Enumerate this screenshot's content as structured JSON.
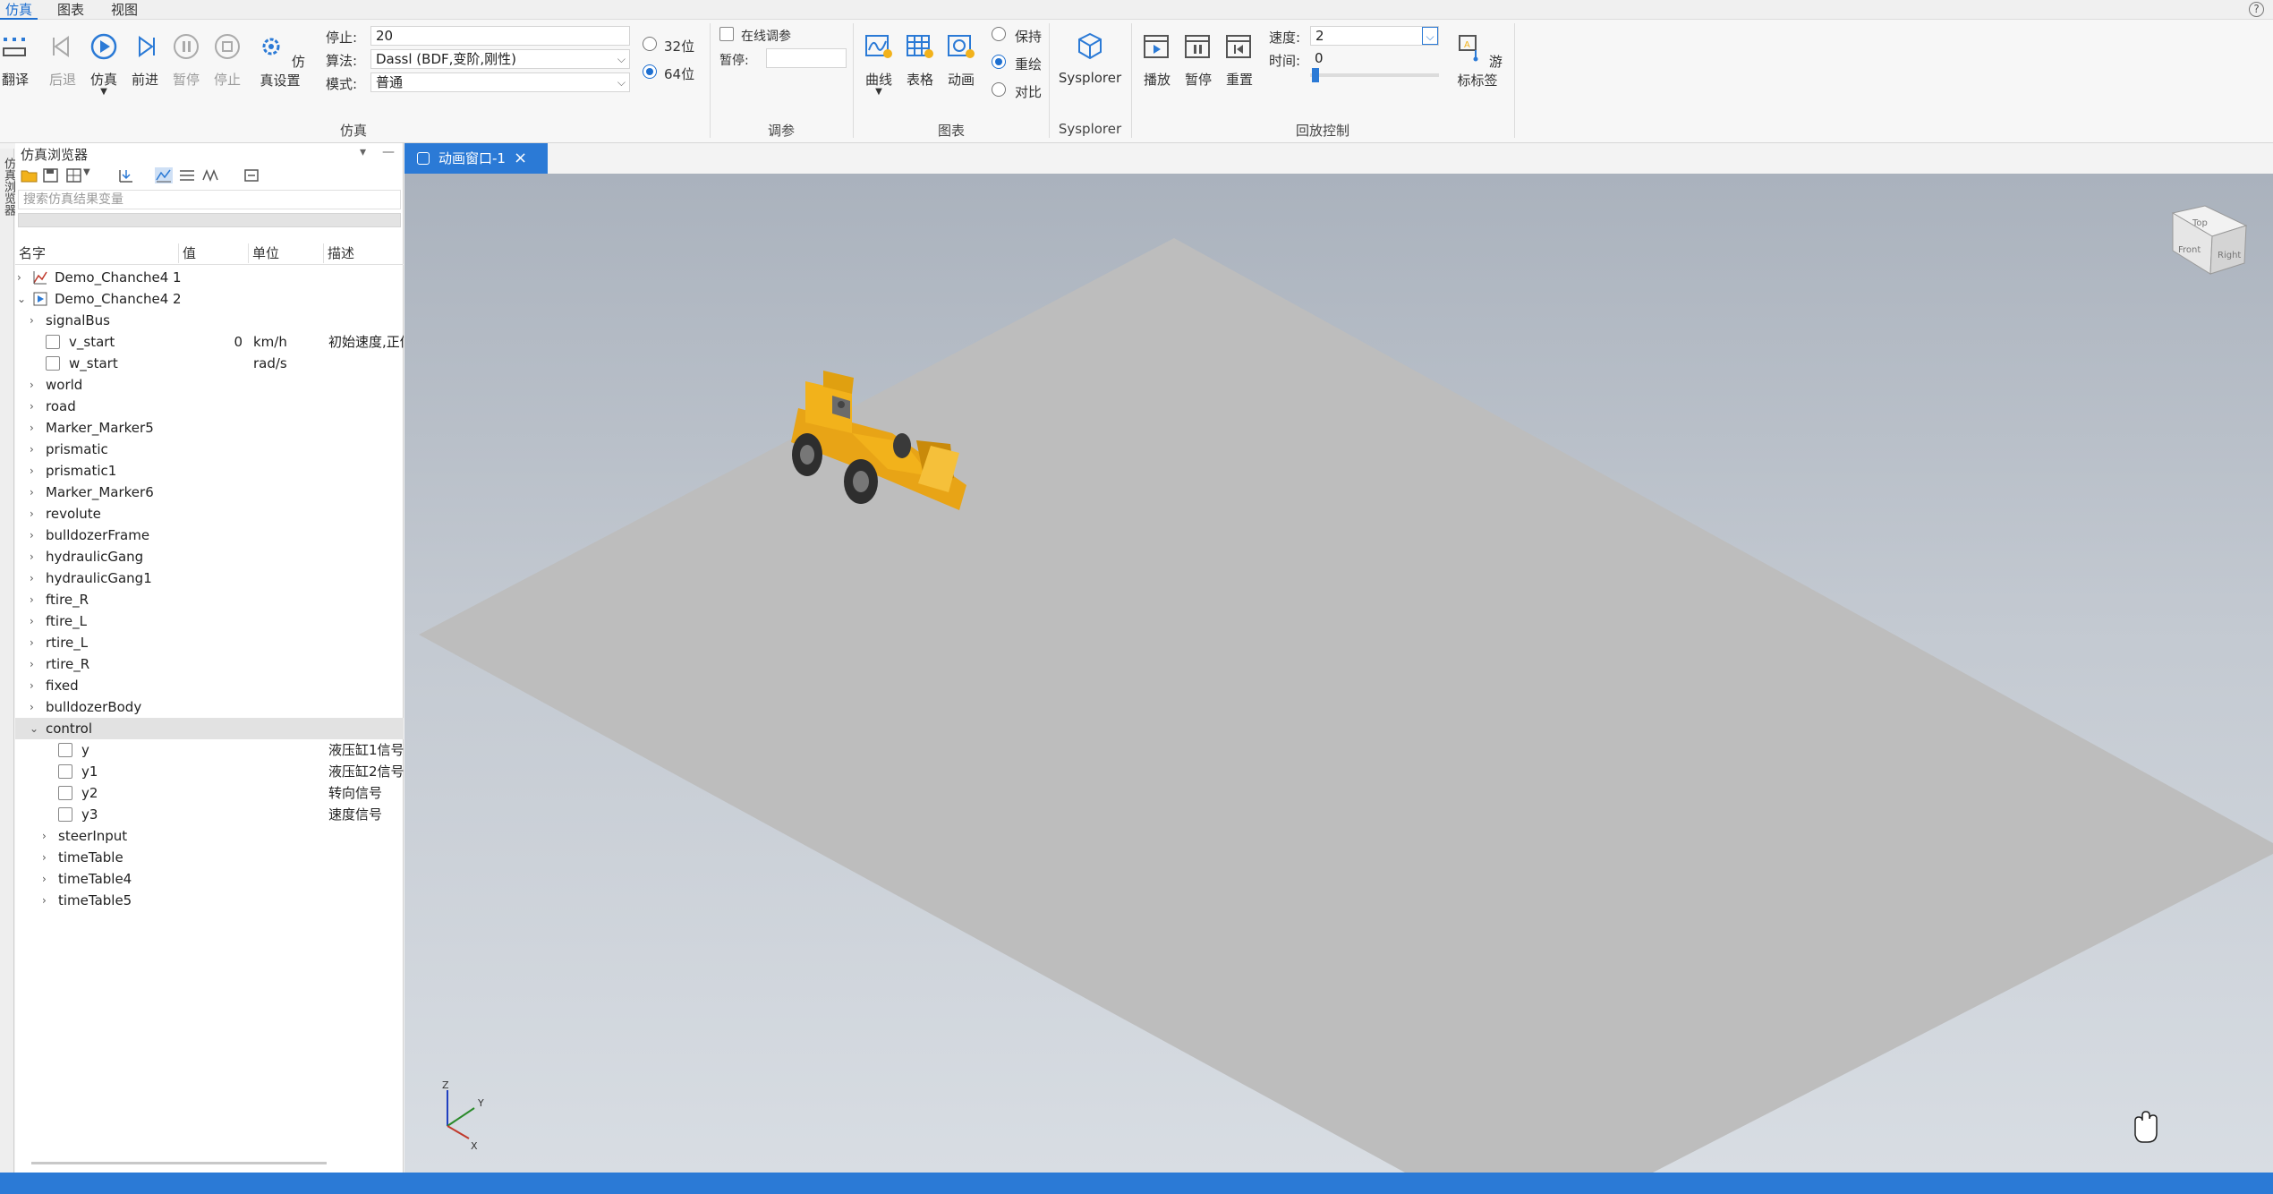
{
  "menu": {
    "items": [
      "仿真",
      "图表",
      "视图"
    ],
    "active": "仿真",
    "help": "?"
  },
  "ribbon": {
    "buttons": {
      "translate": "翻译",
      "back": "后退",
      "simulate": "仿真",
      "forward": "前进",
      "pause": "暂停",
      "stop": "停止",
      "sim_settings": "仿真设置",
      "curve": "曲线",
      "table": "表格",
      "animation": "动画",
      "sysplorer": "Sysplorer",
      "play": "播放",
      "playback_pause": "暂停",
      "reset": "重置",
      "cursor_label": "游标标签"
    },
    "fields": {
      "stop_label": "停止:",
      "stop_value": "20",
      "algo_label": "算法:",
      "algo_value": "Dassl (BDF,变阶,刚性)",
      "mode_label": "模式:",
      "mode_value": "普通",
      "bit32": "32位",
      "bit64": "64位",
      "online_tune": "在线调参",
      "pause_label": "暂停:",
      "keep": "保持",
      "redraw": "重绘",
      "compare": "对比",
      "speed_label": "速度:",
      "speed_value": "2",
      "time_label": "时间:",
      "time_value": "0"
    },
    "groups": {
      "sim": "仿真",
      "tune": "调参",
      "chart": "图表",
      "sysplorer": "Sysplorer",
      "playback": "回放控制"
    }
  },
  "side_tab": "仿真浏览器",
  "browser": {
    "title": "仿真浏览器",
    "search_placeholder": "搜索仿真结果变量",
    "columns": {
      "name": "名字",
      "value": "值",
      "unit": "单位",
      "desc": "描述"
    },
    "rows": [
      {
        "name": "Demo_Chanche4 1"
      },
      {
        "name": "Demo_Chanche4 2"
      },
      {
        "name": "signalBus"
      },
      {
        "name": "v_start",
        "value": "0",
        "unit": "km/h",
        "desc": "初始速度,正值"
      },
      {
        "name": "w_start",
        "unit": "rad/s"
      },
      {
        "name": "world"
      },
      {
        "name": "road"
      },
      {
        "name": "Marker_Marker5"
      },
      {
        "name": "prismatic"
      },
      {
        "name": "prismatic1"
      },
      {
        "name": "Marker_Marker6"
      },
      {
        "name": "revolute"
      },
      {
        "name": "bulldozerFrame"
      },
      {
        "name": "hydraulicGang"
      },
      {
        "name": "hydraulicGang1"
      },
      {
        "name": "ftire_R"
      },
      {
        "name": "ftire_L"
      },
      {
        "name": "rtire_L"
      },
      {
        "name": "rtire_R"
      },
      {
        "name": "fixed"
      },
      {
        "name": "bulldozerBody"
      },
      {
        "name": "control"
      },
      {
        "name": "y",
        "desc": "液压缸1信号"
      },
      {
        "name": "y1",
        "desc": "液压缸2信号"
      },
      {
        "name": "y2",
        "desc": "转向信号"
      },
      {
        "name": "y3",
        "desc": "速度信号"
      },
      {
        "name": "steerInput"
      },
      {
        "name": "timeTable"
      },
      {
        "name": "timeTable4"
      },
      {
        "name": "timeTable5"
      }
    ]
  },
  "doc_tab": {
    "label": "动画窗口-1",
    "close": "×"
  },
  "viewport": {
    "axes": {
      "z": "Z",
      "y": "Y",
      "x": "X"
    },
    "view_cube": {
      "front": "Front",
      "right": "Right",
      "top": "Top"
    }
  },
  "colors": {
    "accent": "#2b7ad6",
    "loader": "#f2b21b"
  }
}
